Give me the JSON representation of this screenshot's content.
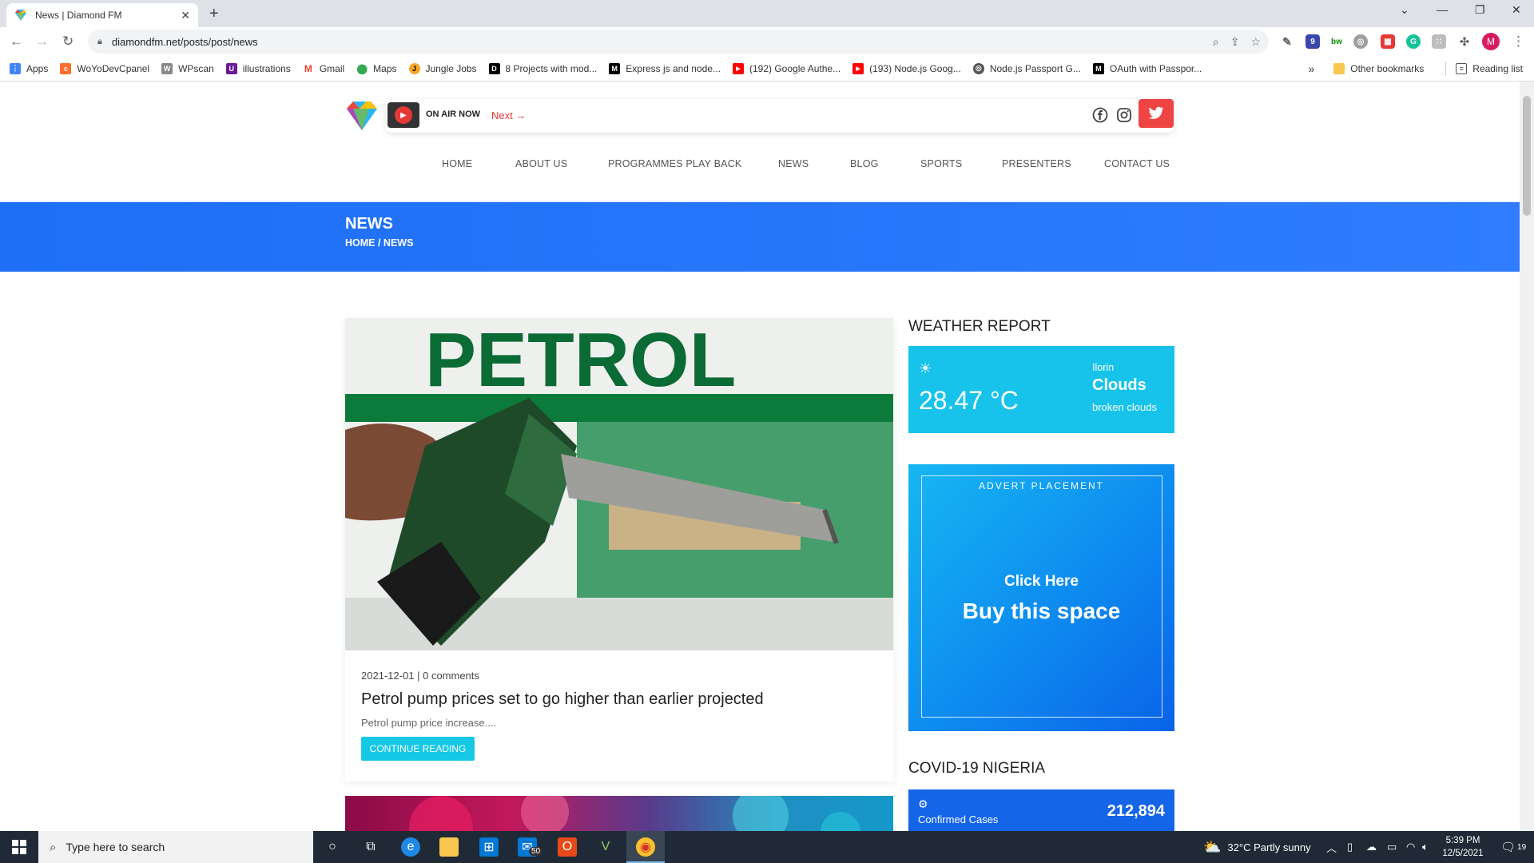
{
  "browser": {
    "tab_title": "News | Diamond FM",
    "new_tab": "+",
    "close_tab": "✕",
    "url": "diamondfm.net/posts/post/news",
    "profile_initial": "M"
  },
  "bookmarks": {
    "items": [
      {
        "label": "Apps",
        "color": "#4285f4",
        "glyph": "⋮"
      },
      {
        "label": "WoYoDevCpanel",
        "color": "#ff6c2c",
        "glyph": "cP"
      },
      {
        "label": "WPscan",
        "color": "#888888",
        "glyph": "W"
      },
      {
        "label": "illustrations",
        "color": "#6a1b9a",
        "glyph": "U"
      },
      {
        "label": "Gmail",
        "color": "#ea4335",
        "glyph": "M"
      },
      {
        "label": "Maps",
        "color": "#34a853",
        "glyph": "◉"
      },
      {
        "label": "Jungle Jobs",
        "color": "#f9a825",
        "glyph": "J"
      },
      {
        "label": "8 Projects with mod...",
        "color": "#000000",
        "glyph": "D"
      },
      {
        "label": "Express js and node...",
        "color": "#000000",
        "glyph": "M"
      },
      {
        "label": "(192) Google Authe...",
        "color": "#ff0000",
        "glyph": "▶"
      },
      {
        "label": "(193) Node.js Goog...",
        "color": "#ff0000",
        "glyph": "▶"
      },
      {
        "label": "Node.js Passport G...",
        "color": "#555555",
        "glyph": "◎"
      },
      {
        "label": "OAuth with Passpor...",
        "color": "#000000",
        "glyph": "M"
      }
    ],
    "more": "»",
    "other": "Other bookmarks",
    "reading": "Reading list"
  },
  "site": {
    "on_air": "ON AIR NOW",
    "next": "Next →",
    "nav": [
      "HOME",
      "ABOUT US",
      "PROGRAMMES PLAY BACK",
      "NEWS",
      "BLOG",
      "SPORTS",
      "PRESENTERS",
      "CONTACT US"
    ],
    "hero_title": "NEWS",
    "breadcrumb": "HOME / NEWS"
  },
  "post": {
    "image_text": "PETROL",
    "meta": "2021-12-01 | 0 comments",
    "title": "Petrol pump prices set to go higher than earlier projected",
    "excerpt": "Petrol pump price increase....",
    "button": "CONTINUE READING"
  },
  "weather": {
    "heading": "WEATHER REPORT",
    "temp": "28.47 °C",
    "city": "Ilorin",
    "condition": "Clouds",
    "description": "broken clouds"
  },
  "advert": {
    "label": "ADVERT PLACEMENT",
    "click": "Click Here",
    "buy": "Buy this space"
  },
  "covid": {
    "heading": "COVID-19 NIGERIA",
    "label": "Confirmed Cases",
    "value": "212,894"
  },
  "taskbar": {
    "search_placeholder": "Type here to search",
    "mail_badge": "50",
    "weather": "32°C  Partly sunny",
    "time": "5:39 PM",
    "date": "12/5/2021",
    "notifications": "19"
  }
}
